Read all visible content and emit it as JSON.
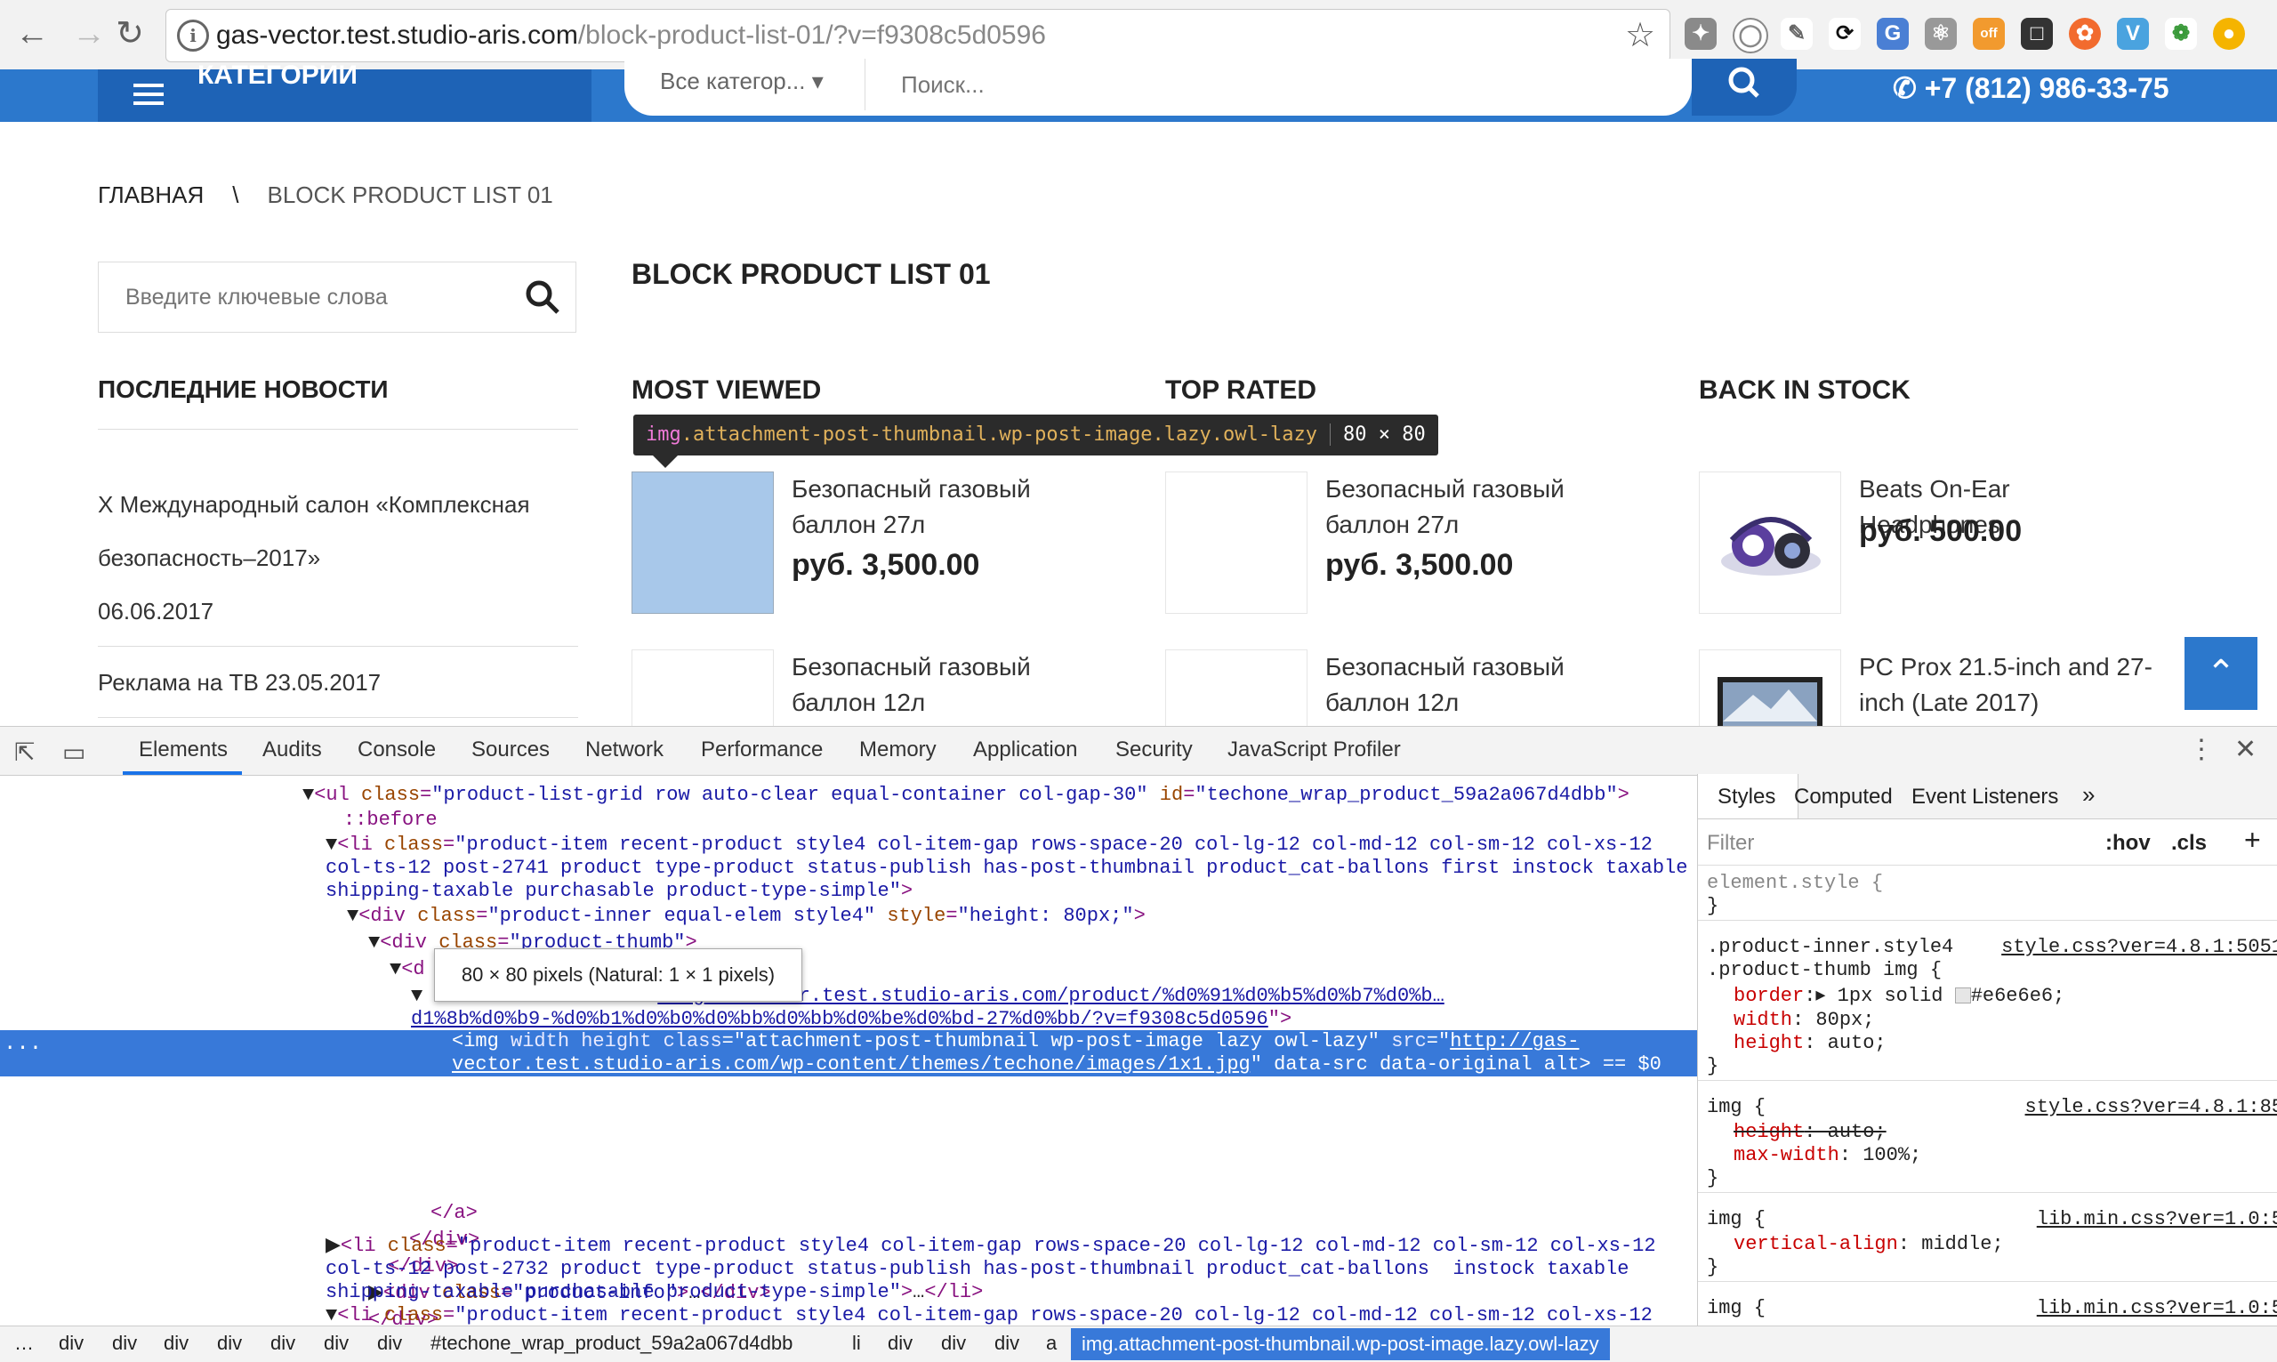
{
  "browser": {
    "url_host": "gas-vector.test.studio-aris.com",
    "url_path": "/block-product-list-01/?v=f9308c5d0596"
  },
  "site": {
    "categories_label": "КАТЕГОРИИ",
    "search_category": "Все категор...",
    "search_placeholder": "Поиск...",
    "phone": "+7 (812) 986-33-75",
    "breadcrumb_home": "ГЛАВНАЯ",
    "breadcrumb_sep": "\\",
    "breadcrumb_current": "BLOCK PRODUCT LIST 01",
    "sidebar_search_placeholder": "Введите ключевые слова",
    "news_title": "ПОСЛЕДНИЕ НОВОСТИ",
    "news": [
      {
        "title_1": "X Международный салон «Комплексная",
        "title_2": "безопасность–2017»",
        "date": "06.06.2017"
      },
      {
        "title": "Реклама на ТВ 23.05.2017"
      }
    ],
    "page_title": "BLOCK PRODUCT LIST 01",
    "columns": [
      {
        "title": "MOST VIEWED",
        "products": [
          {
            "name": "Безопасный газовый баллон 27л",
            "price": "руб. 3,500.00"
          },
          {
            "name": "Безопасный газовый баллон 12л",
            "price": ""
          }
        ]
      },
      {
        "title": "TOP RATED",
        "products": [
          {
            "name": "Безопасный газовый баллон 27л",
            "price": "руб. 3,500.00"
          },
          {
            "name": "Безопасный газовый баллон 12л",
            "price": ""
          }
        ]
      },
      {
        "title": "BACK IN STOCK",
        "products": [
          {
            "name": "Beats On-Ear Headphones",
            "price": "руб. 500.00"
          },
          {
            "name": "PC Prox 21.5-inch and 27-inch (Late 2017)",
            "price": ""
          }
        ]
      }
    ],
    "inspect_tooltip": {
      "tag": "img",
      "classes": ".attachment-post-thumbnail.wp-post-image.lazy.owl-lazy",
      "dims": "80 × 80"
    }
  },
  "devtools": {
    "tabs": [
      "Elements",
      "Audits",
      "Console",
      "Sources",
      "Network",
      "Performance",
      "Memory",
      "Application",
      "Security",
      "JavaScript Profiler"
    ],
    "size_tooltip": "80 × 80 pixels (Natural: 1 × 1 pixels)",
    "styles_tabs": [
      "Styles",
      "Computed",
      "Event Listeners"
    ],
    "filter_placeholder": "Filter",
    "hov": ":hov",
    "cls": ".cls",
    "breadcrumbs": [
      "…",
      "div",
      "div",
      "div",
      "div",
      "div",
      "div",
      "div",
      "#techone_wrap_product_59a2a067d4dbb",
      "li",
      "div",
      "div",
      "div",
      "a"
    ],
    "breadcrumb_selected": "img.attachment-post-thumbnail.wp-post-image.lazy.owl-lazy",
    "ellipsis": "..."
  },
  "colors": {
    "site_blue": "#2c78cc",
    "devtools_select": "#3879d9",
    "placeholder_thumb": "#a8c8ea"
  }
}
